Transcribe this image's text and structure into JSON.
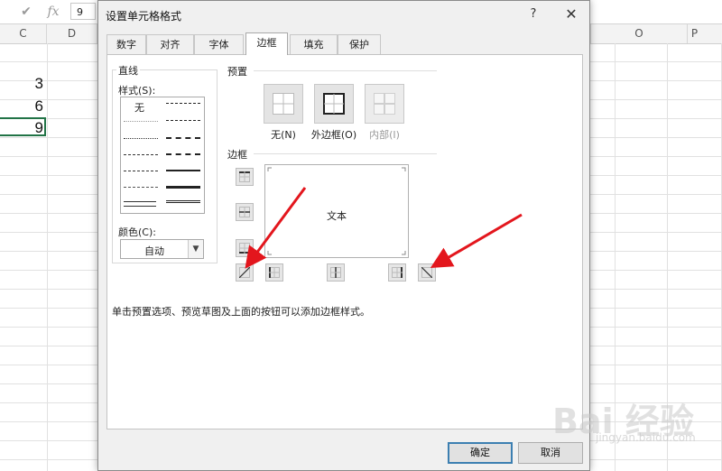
{
  "excel": {
    "formula_bar": {
      "name_box": "9",
      "cancel_icon": "✔",
      "fx_icon": "fx"
    },
    "columns": [
      "C",
      "D",
      "O",
      "P"
    ],
    "cells": [
      "3",
      "6",
      "9"
    ]
  },
  "dialog": {
    "title": "设置单元格格式",
    "help": "?",
    "close": "✕",
    "tabs": [
      {
        "label": "数字"
      },
      {
        "label": "对齐"
      },
      {
        "label": "字体"
      },
      {
        "label": "边框",
        "active": true
      },
      {
        "label": "填充"
      },
      {
        "label": "保护"
      }
    ],
    "line_group": {
      "title": "直线",
      "style_label": "样式(S):",
      "none_label": "无",
      "color_label": "颜色(C):",
      "color_value": "自动"
    },
    "presets": {
      "title": "预置",
      "items": [
        {
          "label": "无(N)",
          "enabled": true
        },
        {
          "label": "外边框(O)",
          "enabled": true
        },
        {
          "label": "内部(I)",
          "enabled": false
        }
      ]
    },
    "border": {
      "title": "边框",
      "preview_text": "文本"
    },
    "hint": "单击预置选项、预览草图及上面的按钮可以添加边框样式。",
    "ok_label": "确定",
    "cancel_label": "取消"
  },
  "colors": {
    "arrow": "#e3161d",
    "selection": "#217346",
    "ok_border": "#3c7fb1"
  },
  "watermark": {
    "text": "Bai 经验",
    "sub": "jingyan.baidu.com"
  }
}
